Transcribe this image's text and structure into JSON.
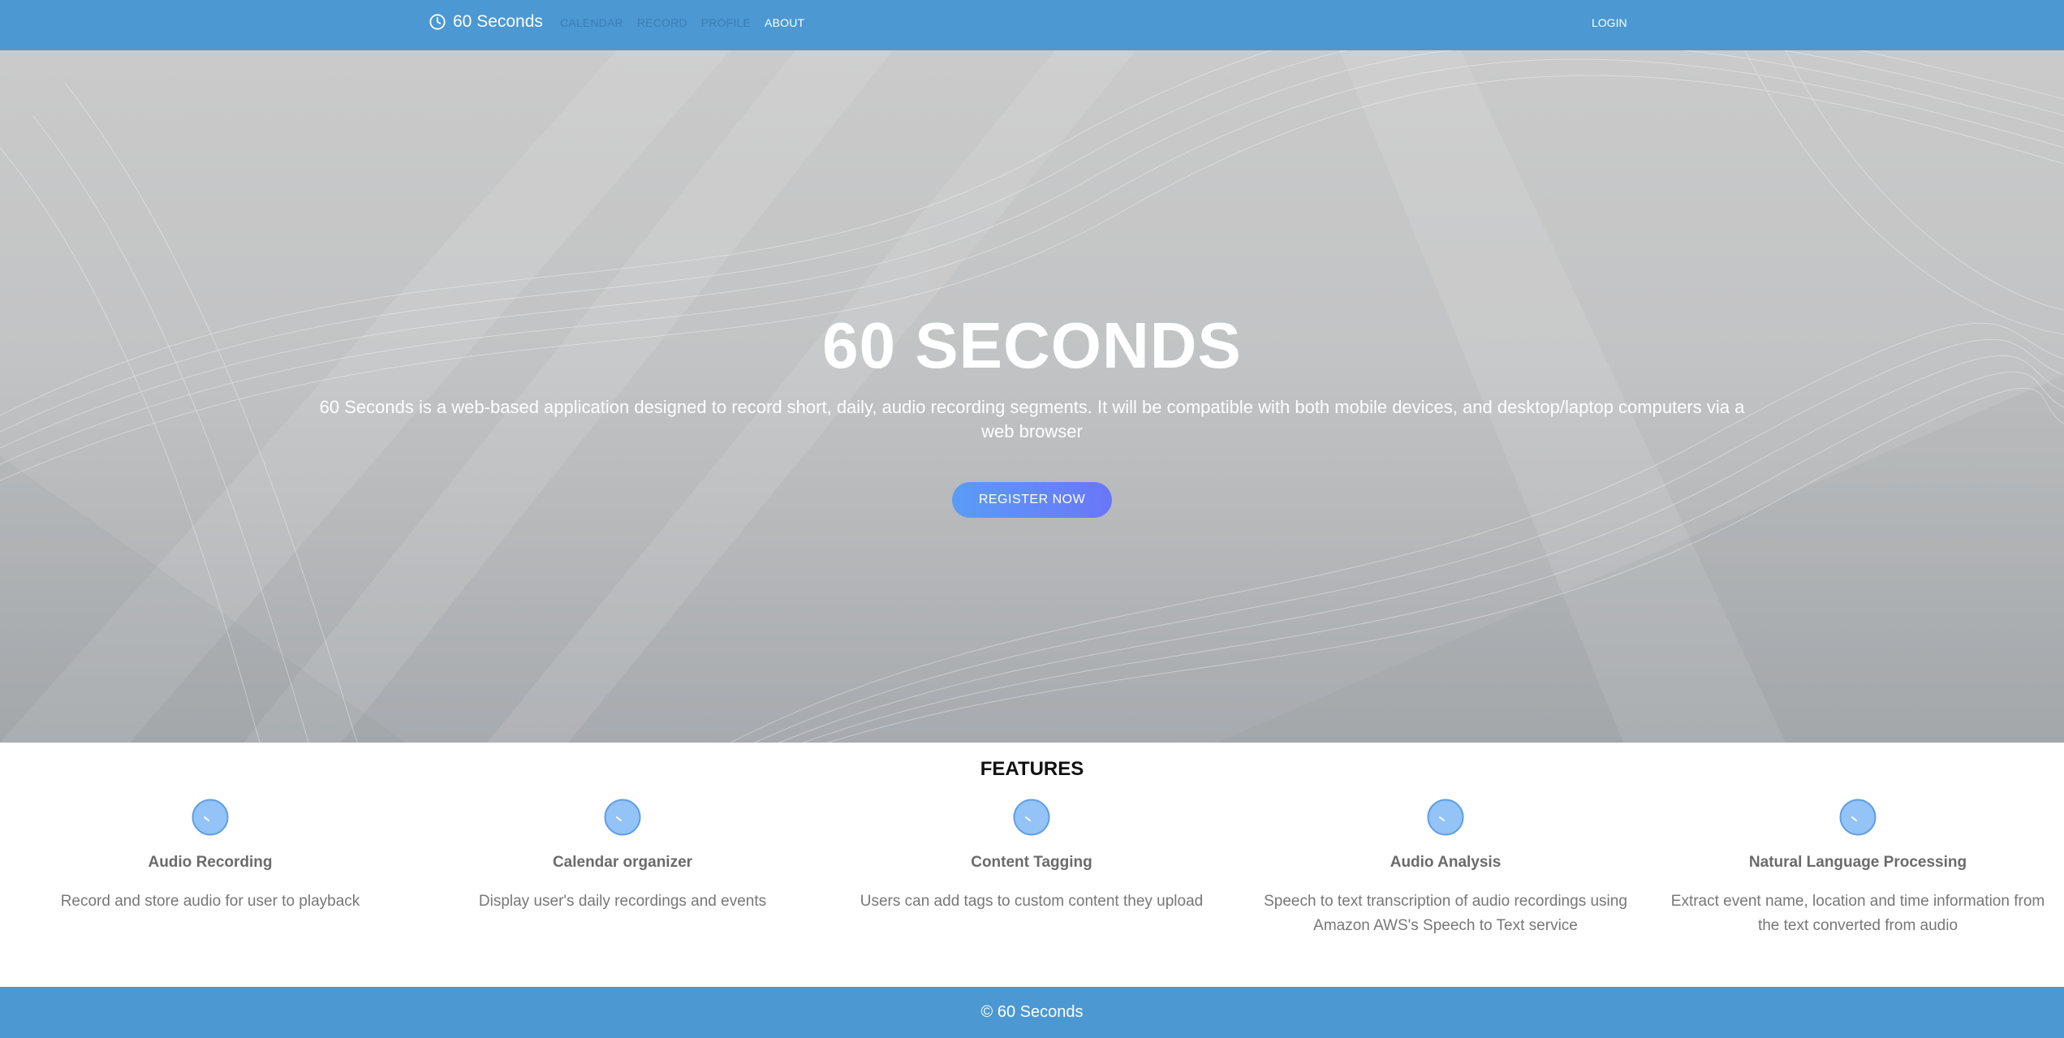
{
  "navbar": {
    "brand": "60 Seconds",
    "brand_icon": "clock-icon",
    "links": [
      "CALENDAR",
      "RECORD",
      "PROFILE",
      "ABOUT"
    ],
    "active_link": "ABOUT",
    "login": "LOGIN",
    "bg_color": "#4b98d2"
  },
  "hero": {
    "title": "60 SECONDS",
    "description": "60 Seconds is a web-based application designed to record short, daily, audio recording segments. It will be compatible with both mobile devices, and desktop/laptop computers via a web browser",
    "cta": "REGISTER NOW"
  },
  "features": {
    "title": "FEATURES",
    "items": [
      {
        "icon": "clock-icon",
        "name": "Audio Recording",
        "description": "Record and store audio for user to playback"
      },
      {
        "icon": "clock-icon",
        "name": "Calendar organizer",
        "description": "Display user's daily recordings and events"
      },
      {
        "icon": "clock-icon",
        "name": "Content Tagging",
        "description": "Users can add tags to custom content they upload"
      },
      {
        "icon": "clock-icon",
        "name": "Audio Analysis",
        "description": "Speech to text transcription of audio recordings using Amazon AWS's Speech to Text service"
      },
      {
        "icon": "clock-icon",
        "name": "Natural Language Processing",
        "description": "Extract event name, location and time information from the text converted from audio"
      }
    ]
  },
  "footer": {
    "text": "© 60 Seconds"
  }
}
